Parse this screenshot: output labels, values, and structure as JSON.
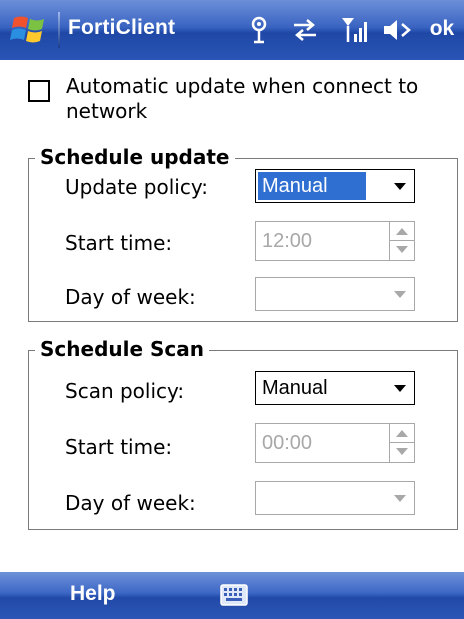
{
  "titlebar": {
    "app_title": "FortiClient",
    "ok_label": "ok",
    "icons": [
      "windows-start-icon",
      "connectivity-icon",
      "sync-icon",
      "signal-strength-icon",
      "speaker-icon"
    ]
  },
  "settings": {
    "auto_update": {
      "label": "Automatic update when connect to network",
      "checked": false
    },
    "schedule_update": {
      "title": "Schedule update",
      "policy_label": "Update policy:",
      "policy_value": "Manual",
      "start_time_label": "Start time:",
      "start_time_value": "12:00",
      "day_label": "Day of week:",
      "day_value": ""
    },
    "schedule_scan": {
      "title": "Schedule Scan",
      "policy_label": "Scan policy:",
      "policy_value": "Manual",
      "start_time_label": "Start time:",
      "start_time_value": "00:00",
      "day_label": "Day of week:",
      "day_value": ""
    }
  },
  "menubar": {
    "help_label": "Help",
    "keyboard_icon": "keyboard-icon"
  },
  "colors": {
    "bar_blue": "#2f5bbb",
    "selection_blue": "#2f6fd2",
    "disabled_gray": "#a8a8a8"
  }
}
